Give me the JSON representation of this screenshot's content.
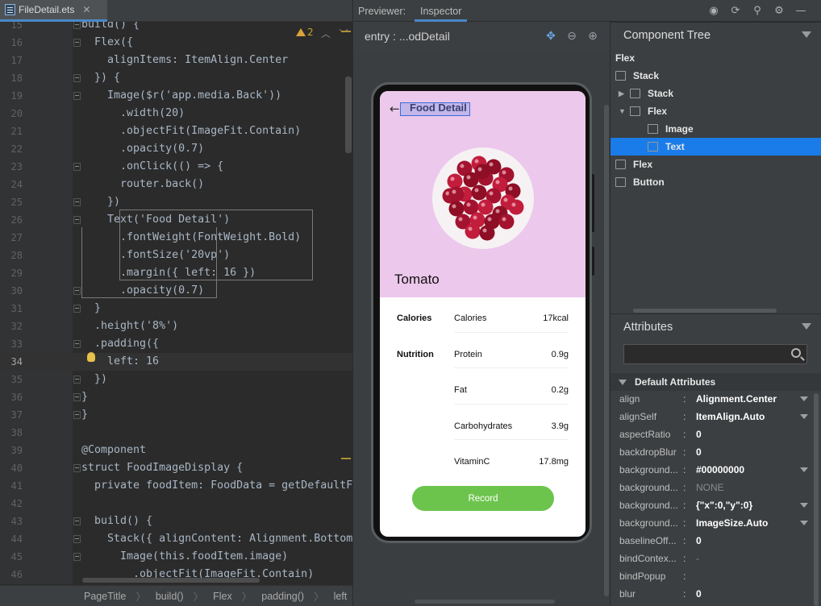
{
  "editor": {
    "tab_label": "FileDetail.ets",
    "tab_close": "✕",
    "warning_count": "2",
    "lines": [
      {
        "n": "15",
        "code": "build() {"
      },
      {
        "n": "16",
        "code": "  Flex({"
      },
      {
        "n": "17",
        "code": "    alignItems: ItemAlign.Center"
      },
      {
        "n": "18",
        "code": "  }) {"
      },
      {
        "n": "19",
        "code": "    Image($r('app.media.Back'))"
      },
      {
        "n": "20",
        "code": "      .width(20)"
      },
      {
        "n": "21",
        "code": "      .objectFit(ImageFit.Contain)"
      },
      {
        "n": "22",
        "code": "      .opacity(0.7)"
      },
      {
        "n": "23",
        "code": "      .onClick(() => {"
      },
      {
        "n": "24",
        "code": "      router.back()"
      },
      {
        "n": "25",
        "code": "    })"
      },
      {
        "n": "26",
        "code": "    Text('Food Detail')"
      },
      {
        "n": "27",
        "code": "      .fontWeight(FontWeight.Bold)"
      },
      {
        "n": "28",
        "code": "      .fontSize('20vp')"
      },
      {
        "n": "29",
        "code": "      .margin({ left: 16 })"
      },
      {
        "n": "30",
        "code": "      .opacity(0.7)"
      },
      {
        "n": "31",
        "code": "  }"
      },
      {
        "n": "32",
        "code": "  .height('8%')"
      },
      {
        "n": "33",
        "code": "  .padding({"
      },
      {
        "n": "34",
        "code": "    left: 16"
      },
      {
        "n": "35",
        "code": "  })"
      },
      {
        "n": "36",
        "code": "}"
      },
      {
        "n": "37",
        "code": "}"
      },
      {
        "n": "38",
        "code": ""
      },
      {
        "n": "39",
        "code": "@Component"
      },
      {
        "n": "40",
        "code": "struct FoodImageDisplay {"
      },
      {
        "n": "41",
        "code": "  private foodItem: FoodData = getDefaultF"
      },
      {
        "n": "42",
        "code": ""
      },
      {
        "n": "43",
        "code": "  build() {"
      },
      {
        "n": "44",
        "code": "    Stack({ alignContent: Alignment.Bottom"
      },
      {
        "n": "45",
        "code": "      Image(this.foodItem.image)"
      },
      {
        "n": "46",
        "code": "        .objectFit(ImageFit.Contain)"
      }
    ],
    "breadcrumbs": [
      "PageTitle",
      "build()",
      "Flex",
      "padding()",
      "left"
    ]
  },
  "preview": {
    "tab_previewer": "Previewer:",
    "tab_inspector": "Inspector",
    "header": "entry : ...odDetail",
    "app": {
      "title": "Food Detail",
      "food_name": "Tomato",
      "rows": [
        {
          "label": "Calories",
          "name": "Calories",
          "value": "17kcal"
        },
        {
          "label": "Nutrition",
          "name": "Protein",
          "value": "0.9g"
        },
        {
          "label": "",
          "name": "Fat",
          "value": "0.2g"
        },
        {
          "label": "",
          "name": "Carbohydrates",
          "value": "3.9g"
        },
        {
          "label": "",
          "name": "VitaminC",
          "value": "17.8mg"
        }
      ],
      "button": "Record"
    }
  },
  "tree": {
    "title": "Component Tree",
    "items": [
      {
        "label": "Flex",
        "depth": 0,
        "icon": ""
      },
      {
        "label": "Stack",
        "depth": 0,
        "icon": "flex-icon"
      },
      {
        "label": "Stack",
        "depth": 1,
        "icon": "flex-icon",
        "arrow": "▶"
      },
      {
        "label": "Flex",
        "depth": 1,
        "icon": "flex-icon",
        "arrow": "▼"
      },
      {
        "label": "Image",
        "depth": 2,
        "icon": "image-icon"
      },
      {
        "label": "Text",
        "depth": 2,
        "icon": "text-icon",
        "selected": true
      },
      {
        "label": "Flex",
        "depth": 0,
        "icon": "flex-icon"
      },
      {
        "label": "Button",
        "depth": 0,
        "icon": "button-icon"
      }
    ]
  },
  "attributes": {
    "title": "Attributes",
    "group": "Default Attributes",
    "rows": [
      {
        "key": "align",
        "value": "Alignment.Center",
        "dropdown": true
      },
      {
        "key": "alignSelf",
        "value": "ItemAlign.Auto",
        "dropdown": true
      },
      {
        "key": "aspectRatio",
        "value": "0"
      },
      {
        "key": "backdropBlur",
        "value": "0"
      },
      {
        "key": "background...",
        "value": "#00000000",
        "dropdown": true
      },
      {
        "key": "background...",
        "value": "NONE",
        "dim": true
      },
      {
        "key": "background...",
        "value": "{\"x\":0,\"y\":0}",
        "dropdown": true
      },
      {
        "key": "background...",
        "value": "ImageSize.Auto",
        "dropdown": true
      },
      {
        "key": "baselineOff...",
        "value": "0"
      },
      {
        "key": "bindContex...",
        "value": "-",
        "dim": true
      },
      {
        "key": "bindPopup",
        "value": ""
      },
      {
        "key": "blur",
        "value": "0"
      }
    ]
  },
  "colors": {
    "accent": "#4a88c7",
    "selection": "#1a7ce8",
    "hero_bg": "#ecc8ec",
    "record_btn": "#6cc44d"
  }
}
